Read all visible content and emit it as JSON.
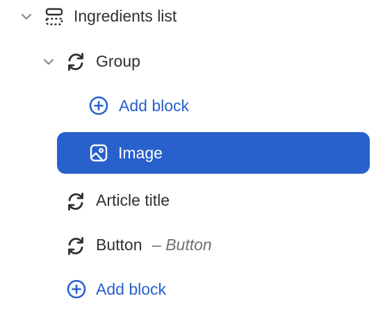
{
  "tree": {
    "section": {
      "label": "Ingredients list",
      "icon": "section-icon",
      "expanded": true
    },
    "group": {
      "label": "Group",
      "icon": "sync-icon",
      "expanded": true
    },
    "group_add_block": {
      "label": "Add block",
      "icon": "plus-circle-icon"
    },
    "image": {
      "label": "Image",
      "icon": "image-icon",
      "selected": true
    },
    "article_title": {
      "label": "Article title",
      "icon": "sync-icon"
    },
    "button": {
      "label": "Button",
      "dash": "–",
      "sublabel": "Button",
      "icon": "sync-icon"
    },
    "add_block": {
      "label": "Add block",
      "icon": "plus-circle-icon"
    }
  },
  "colors": {
    "accent": "#2860cc",
    "text": "#303030",
    "muted": "#707070",
    "selected_text": "#ffffff"
  }
}
